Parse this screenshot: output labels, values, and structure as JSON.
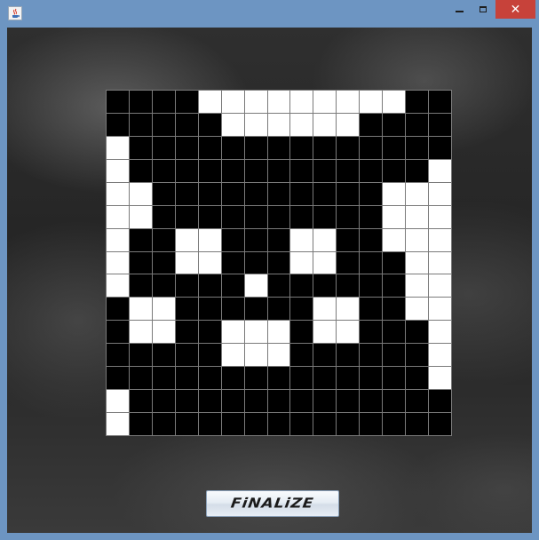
{
  "window": {
    "title": "",
    "icon": "java-coffee-cup-icon",
    "controls": {
      "minimize_icon": "minimize-icon",
      "maximize_icon": "maximize-icon",
      "close_glyph": "✕"
    }
  },
  "board": {
    "rows": 15,
    "cols": 15,
    "cells": [
      "000011111111100",
      "000001111110000",
      "100000000000000",
      "100000000000001",
      "110000000000111",
      "110000000000111",
      "100110001100111",
      "100110001100011",
      "100000100000011",
      "011000000110011",
      "011001110110001",
      "000001110000001",
      "000000000000001",
      "100000000000000",
      "100000000000000"
    ],
    "on_color": "#ffffff",
    "off_color": "#000000"
  },
  "finalize_button": {
    "label": "FiNALiZE"
  }
}
